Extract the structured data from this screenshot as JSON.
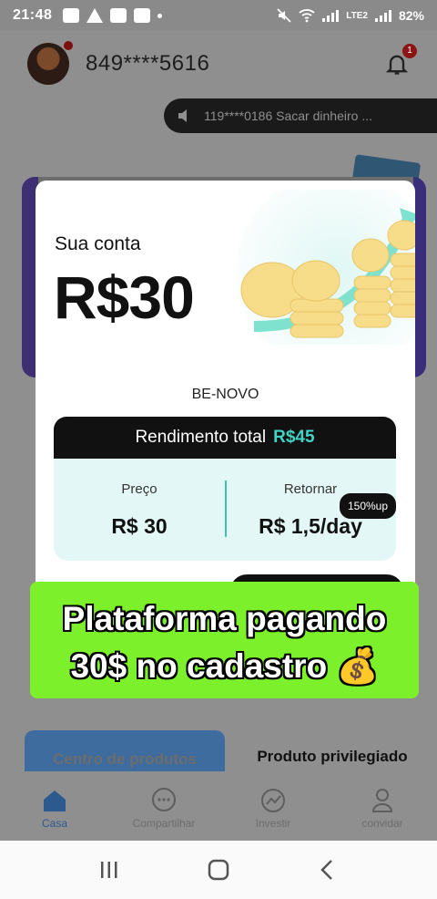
{
  "status": {
    "time": "21:48",
    "battery": "82%",
    "network": "LTE2"
  },
  "header": {
    "phone": "849****5616",
    "notifications": "1"
  },
  "marquee": {
    "text": "119****0186 Sacar dinheiro ..."
  },
  "card": {
    "label": "Sua conta",
    "amount": "R$30",
    "plan": "BE-NOVO",
    "total_label": "Rendimento total",
    "total_value": "R$45",
    "price_label": "Preço",
    "price_value": "R$ 30",
    "return_label": "Retornar",
    "return_value": "R$ 1,5/day",
    "return_tag": "150%up"
  },
  "banner": {
    "line1": "Plataforma pagando",
    "line2": "30$ no cadastro 💰"
  },
  "tabs": {
    "left": "Centro de produtos",
    "right": "Produto privilegiado"
  },
  "nav": [
    {
      "label": "Casa",
      "icon": "home-icon"
    },
    {
      "label": "Compartilhar",
      "icon": "share-icon"
    },
    {
      "label": "Investir",
      "icon": "invest-icon"
    },
    {
      "label": "convidar",
      "icon": "invite-icon"
    }
  ],
  "colors": {
    "accent": "#41d3c4",
    "banner": "#7cf02a",
    "active_nav": "#2d5a8e"
  }
}
